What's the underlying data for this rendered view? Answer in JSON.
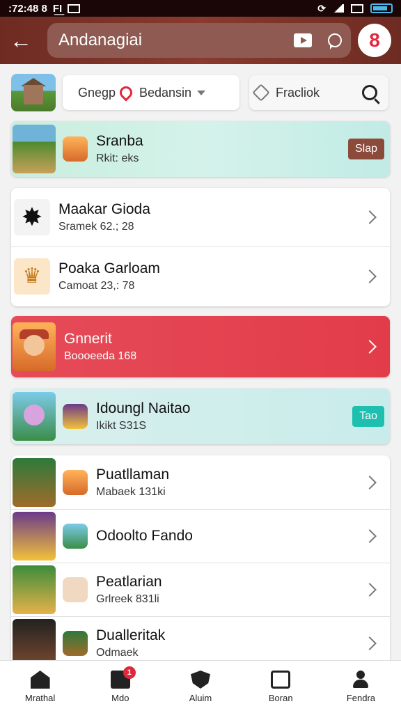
{
  "status_bar": {
    "time": ":72:48 8",
    "left_icons": [
      "sim-icon",
      "notification-icon"
    ]
  },
  "header": {
    "back_icon": "back-arrow-icon",
    "search_text": "Andanagiai",
    "icons": [
      "play-icon",
      "chat-icon"
    ],
    "logo_text": "8",
    "accent": "#7a3026"
  },
  "filters": {
    "tab_label": "Gnegp",
    "location_label": "Bedansin",
    "sort_label": "Fracliok"
  },
  "featured": {
    "title": "Sranba",
    "subtitle": "Rkit: eks",
    "button_label": "Slap",
    "button_color": "#8b4a3a"
  },
  "list_one": [
    {
      "title": "Maakar Gioda",
      "subtitle": "Sramek 62.; 28"
    },
    {
      "title": "Poaka Garloam",
      "subtitle": "Camoat 23,: 78"
    }
  ],
  "promo": {
    "title": "Gnnerit",
    "subtitle": "Boooeeda 168",
    "color": "#e43d4b"
  },
  "highlight": {
    "title": "Idoungl Naitao",
    "subtitle": "Ikikt S31S",
    "button_label": "Tao",
    "button_color": "#1fbfb0"
  },
  "list_two": [
    {
      "title": "Puatllaman",
      "subtitle": "Mabaek 131ki"
    },
    {
      "title": "Odoolto Fando",
      "subtitle": ""
    },
    {
      "title": "Peatlarian",
      "subtitle": "Grlreek 831li"
    },
    {
      "title": "Dualleritak",
      "subtitle": "Odmaek"
    }
  ],
  "bottom_nav": [
    {
      "label": "Mrathal",
      "icon": "home-icon"
    },
    {
      "label": "Mdo",
      "icon": "mail-icon",
      "badge": "1"
    },
    {
      "label": "Aluim",
      "icon": "shield-icon"
    },
    {
      "label": "Boran",
      "icon": "store-icon"
    },
    {
      "label": "Fendra",
      "icon": "user-icon"
    }
  ]
}
